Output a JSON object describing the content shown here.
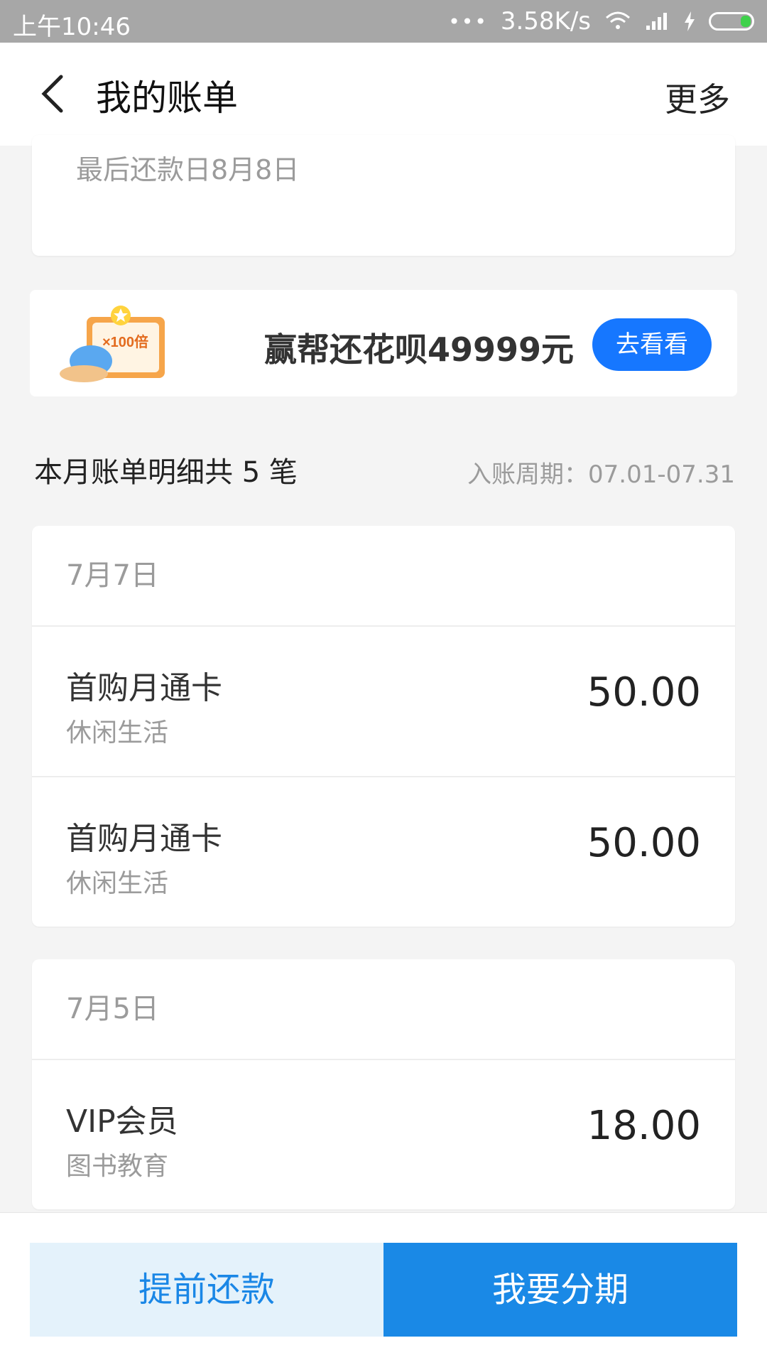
{
  "status_bar": {
    "time": "上午10:46",
    "speed": "3.58K/s",
    "battery_color": "#3fd14b"
  },
  "header": {
    "title": "我的账单",
    "more": "更多"
  },
  "bill_card": {
    "last_repay_day": "最后还款日8月8日"
  },
  "promo": {
    "badge_text": "×100倍",
    "text": "赢帮还花呗49999元",
    "button": "去看看",
    "accent": "#1677ff"
  },
  "summary": {
    "title": "本月账单明细共 5 笔",
    "period": "入账周期：07.01-07.31"
  },
  "groups": [
    {
      "date": "7月7日",
      "items": [
        {
          "name": "首购月通卡",
          "category": "休闲生活",
          "amount": "50.00"
        },
        {
          "name": "首购月通卡",
          "category": "休闲生活",
          "amount": "50.00"
        }
      ]
    },
    {
      "date": "7月5日",
      "items": [
        {
          "name": "VIP会员",
          "category": "图书教育",
          "amount": "18.00"
        }
      ]
    }
  ],
  "bottom": {
    "repay": "提前还款",
    "split": "我要分期",
    "repay_bg": "#e4f2fb",
    "split_bg": "#1a89e6"
  }
}
